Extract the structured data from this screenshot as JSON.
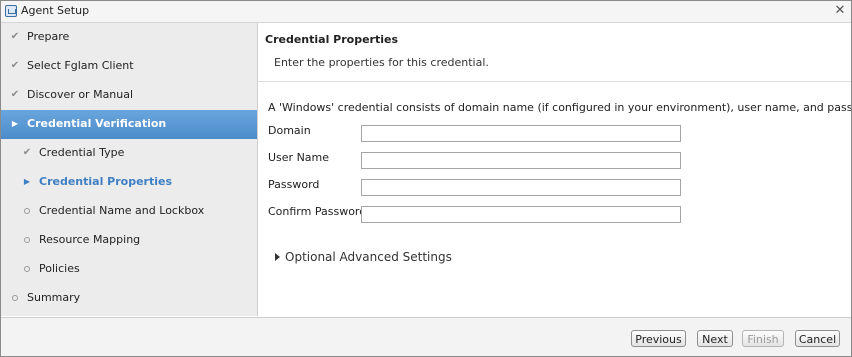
{
  "window": {
    "title": "Agent Setup",
    "app_icon": "app-icon",
    "close_icon": "close-icon",
    "close_glyph": "✕"
  },
  "sidebar": {
    "steps": [
      {
        "label": "Prepare",
        "state": "done",
        "icon": "check-icon",
        "glyph": "✔"
      },
      {
        "label": "Select Fglam Client",
        "state": "done",
        "icon": "check-icon",
        "glyph": "✔"
      },
      {
        "label": "Discover or Manual",
        "state": "done",
        "icon": "check-icon",
        "glyph": "✔"
      },
      {
        "label": "Credential Verification",
        "state": "active",
        "icon": "arrow-right-icon",
        "glyph": "▶"
      },
      {
        "label": "Credential Type",
        "state": "done",
        "icon": "check-icon",
        "glyph": "✔"
      },
      {
        "label": "Credential Properties",
        "state": "current",
        "icon": "arrow-right-icon",
        "glyph": "▶"
      },
      {
        "label": "Credential Name and Lockbox",
        "state": "pending",
        "icon": "circle-icon"
      },
      {
        "label": "Resource Mapping",
        "state": "pending",
        "icon": "circle-icon"
      },
      {
        "label": "Policies",
        "state": "pending",
        "icon": "circle-icon"
      },
      {
        "label": "Summary",
        "state": "pending",
        "icon": "circle-icon"
      }
    ],
    "active_color": "#5b9bd5",
    "current_color": "#3e7fc4"
  },
  "main": {
    "title": "Credential Properties",
    "description": "Enter the properties for this credential.",
    "info": "A 'Windows' credential consists of domain name (if configured in your environment), user name, and password.",
    "fields": [
      {
        "label": "Domain",
        "value": ""
      },
      {
        "label": "User Name",
        "value": ""
      },
      {
        "label": "Password",
        "value": ""
      },
      {
        "label": "Confirm Password",
        "value": ""
      }
    ],
    "advanced_label": "Optional Advanced Settings"
  },
  "footer": {
    "previous": "Previous",
    "next": "Next",
    "finish": "Finish",
    "cancel": "Cancel"
  }
}
